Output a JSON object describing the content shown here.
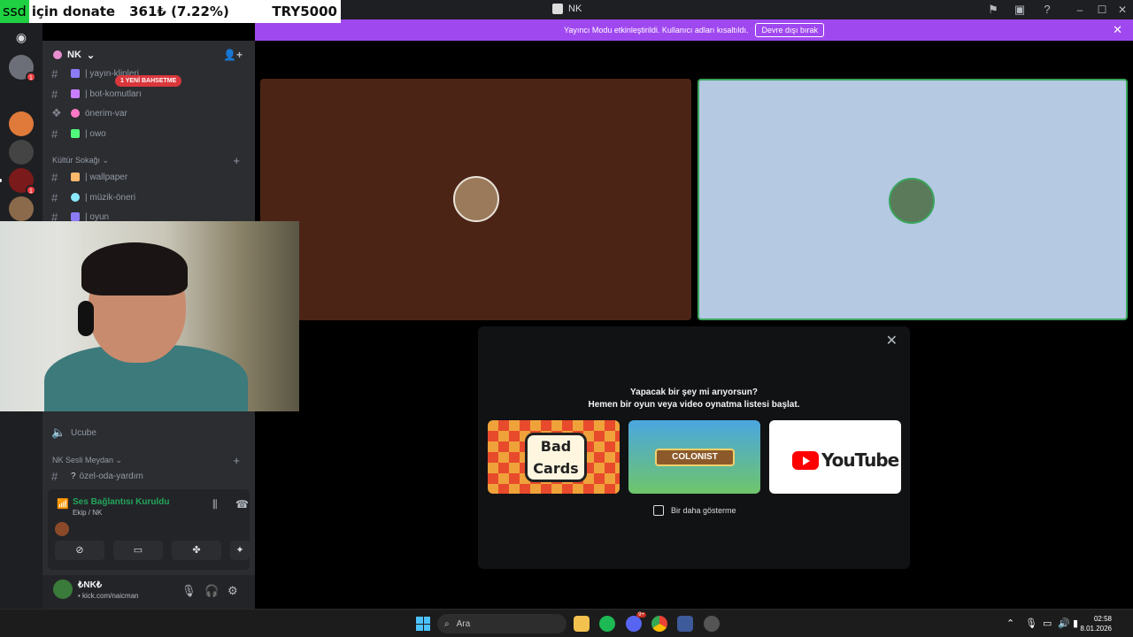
{
  "window": {
    "title": "NK"
  },
  "donate": {
    "tag": "ssd",
    "text": "için donate",
    "amount": "361₺ (7.22%)",
    "goal": "TRY5000"
  },
  "banner": {
    "message": "Yayıncı Modu etkinleştirildi. Kullanıcı adları kısaltıldı.",
    "button": "Devre dışı bırak"
  },
  "server": {
    "name": "NK"
  },
  "mention_pill": "1 YENİ BAHSETME",
  "channels_top": [
    {
      "label": "| yayın-klipleri",
      "color": "#8b7cf6"
    },
    {
      "label": "| bot-komutları",
      "color": "#c77dff"
    },
    {
      "label": "önerim-var",
      "color": "#ff79c6"
    },
    {
      "label": "| owo",
      "color": "#50fa7b"
    }
  ],
  "category_kultur": "Kültür Sokağı",
  "channels_kultur": [
    {
      "label": "| wallpaper",
      "color": "#ffb86c"
    },
    {
      "label": "| müzik-öneri",
      "color": "#8be9fd"
    },
    {
      "label": "| oyun",
      "color": "#8b7cf6"
    }
  ],
  "voice_channel_ucube": "Ucube",
  "category_sesli": "NK Sesli Meydan",
  "channel_ozel": "özel-oda-yardım",
  "voice": {
    "status": "Ses Bağlantısı Kuruldu",
    "location": "Ekip / NK"
  },
  "user": {
    "name": "₺NK₺",
    "status": "• kick.com/naicman"
  },
  "popup": {
    "question": "Yapacak bir şey mi arıyorsun?",
    "subtitle": "Hemen bir oyun veya video oynatma listesi başlat.",
    "cards": [
      "Bad Cards",
      "COLONIST",
      "YouTube"
    ],
    "checkbox": "Bir daha gösterme"
  },
  "taskbar": {
    "search": "Ara",
    "discord_badge": "9+",
    "time": "02:58",
    "date": "8.01.2026"
  }
}
